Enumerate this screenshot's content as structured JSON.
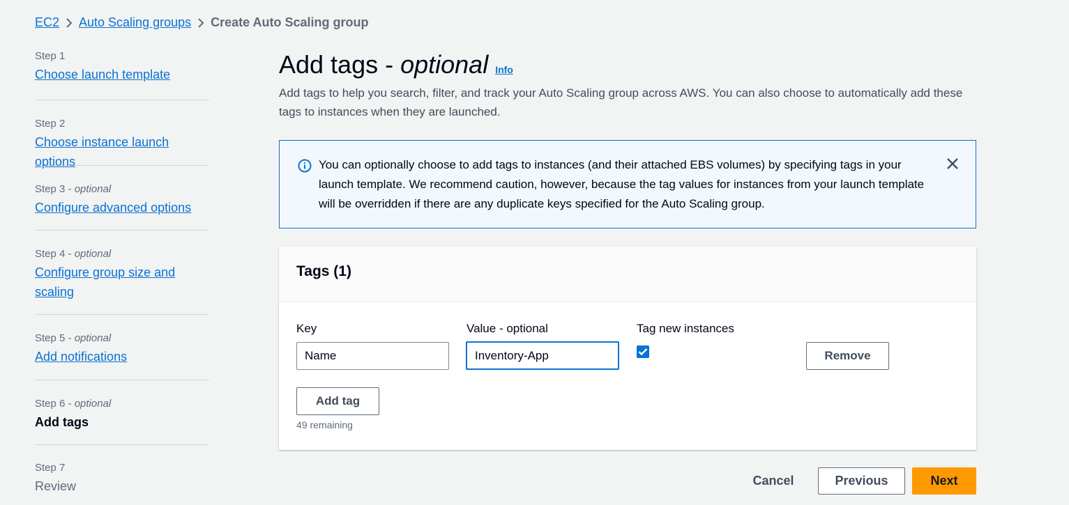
{
  "breadcrumb": {
    "ec2": "EC2",
    "asg": "Auto Scaling groups",
    "current": "Create Auto Scaling group"
  },
  "steps": [
    {
      "num": "Step 1",
      "opt": "",
      "label": "Choose launch template"
    },
    {
      "num": "Step 2",
      "opt": "",
      "label": "Choose instance launch options"
    },
    {
      "num": "Step 3 - ",
      "opt": "optional",
      "label": "Configure advanced options"
    },
    {
      "num": "Step 4 - ",
      "opt": "optional",
      "label": "Configure group size and scaling"
    },
    {
      "num": "Step 5 - ",
      "opt": "optional",
      "label": "Add notifications"
    },
    {
      "num": "Step 6 - ",
      "opt": "optional",
      "label": "Add tags"
    },
    {
      "num": "Step 7",
      "opt": "",
      "label": "Review"
    }
  ],
  "page": {
    "title": "Add tags - ",
    "title_em": "optional",
    "info": "Info",
    "description": "Add tags to help you search, filter, and track your Auto Scaling group across AWS. You can also choose to automatically add these tags to instances when they are launched."
  },
  "alert": {
    "text": "You can optionally choose to add tags to instances (and their attached EBS volumes) by specifying tags in your launch template. We recommend caution, however, because the tag values for instances from your launch template will be overridden if there are any duplicate keys specified for the Auto Scaling group."
  },
  "tags": {
    "header": "Tags (1)",
    "key_label": "Key",
    "value_label": "Value - optional",
    "tag_new_label": "Tag new instances",
    "key_value": "Name",
    "value_value": "Inventory-App",
    "tag_new_checked": true,
    "remove": "Remove",
    "add_tag": "Add tag",
    "remaining": "49 remaining"
  },
  "footer": {
    "cancel": "Cancel",
    "previous": "Previous",
    "next": "Next"
  },
  "colors": {
    "link": "#0972d3",
    "primary": "#ff9900",
    "alert_bg": "#f2f8fd"
  }
}
